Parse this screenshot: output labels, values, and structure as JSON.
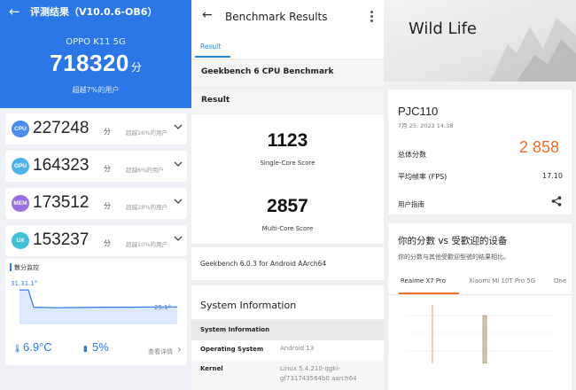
{
  "antutu": {
    "back_icon": "arrow-left-icon",
    "title": "评测结果（V10.0.6-OB6）",
    "model": "OPPO K11 5G",
    "total_score": "718320",
    "score_unit": "分",
    "beat_text": "超越7%的用户",
    "rows": [
      {
        "badge": "CPU",
        "value": "227248",
        "unit": "分",
        "beat": "超越16%的用户",
        "color": "#4a8df0"
      },
      {
        "badge": "GPU",
        "value": "164323",
        "unit": "分",
        "beat": "超越6%的用户",
        "color": "#4fb3e8"
      },
      {
        "badge": "MEM",
        "value": "173512",
        "unit": "分",
        "beat": "超越28%的用户",
        "color": "#9a6fe0"
      },
      {
        "badge": "UX",
        "value": "153237",
        "unit": "分",
        "beat": "超越10%的用户",
        "color": "#41c1d8"
      }
    ],
    "temp": {
      "title": "散分监控",
      "start_label": "31.31.1°",
      "end_label": "25.1°",
      "temp_rise": "6.9°C",
      "battery_drop": "5%",
      "more": "查看详情",
      "temperature_curve": [
        31.3,
        31.3,
        25.0,
        24.8,
        24.9,
        25.0,
        25.0,
        25.1,
        25.1
      ]
    }
  },
  "geekbench": {
    "back_icon": "arrow-left-icon",
    "title": "Benchmark Results",
    "menu_icon": "more-vertical-icon",
    "tab": "Result",
    "bench_name": "Geekbench 6 CPU Benchmark",
    "result_header": "Result",
    "single_score": "1123",
    "single_label": "Single-Core Score",
    "multi_score": "2857",
    "multi_label": "Multi-Core Score",
    "version": "Geekbench 6.0.3 for Android AArch64",
    "sys_header": "System Information",
    "sys_rows": [
      {
        "key": "System Information",
        "value": ""
      },
      {
        "key": "Operating System",
        "value": "Android 13"
      },
      {
        "key": "Kernel",
        "value": "Linux 5.4.210-qgki-gf731743564b0 aarch64"
      }
    ]
  },
  "wildlife": {
    "title": "Wild Life",
    "model": "PJC110",
    "date": "7月 25, 2023 14:38",
    "total_label": "总体分数",
    "total_score": "2 858",
    "fps_label": "平均帧率 (FPS)",
    "fps_value": "17.10",
    "guide_label": "用户指南",
    "share_icon": "share-icon",
    "compare_title": "你的分數 vs 受歡迎的设备",
    "compare_sub": "你的分数与其他受歡迎型號的结果相比。",
    "compare_tabs": [
      "Realme X7 Pro",
      "Xiaomi Mi 10T Pro 5G",
      "One"
    ],
    "accent": "#e8702a"
  }
}
